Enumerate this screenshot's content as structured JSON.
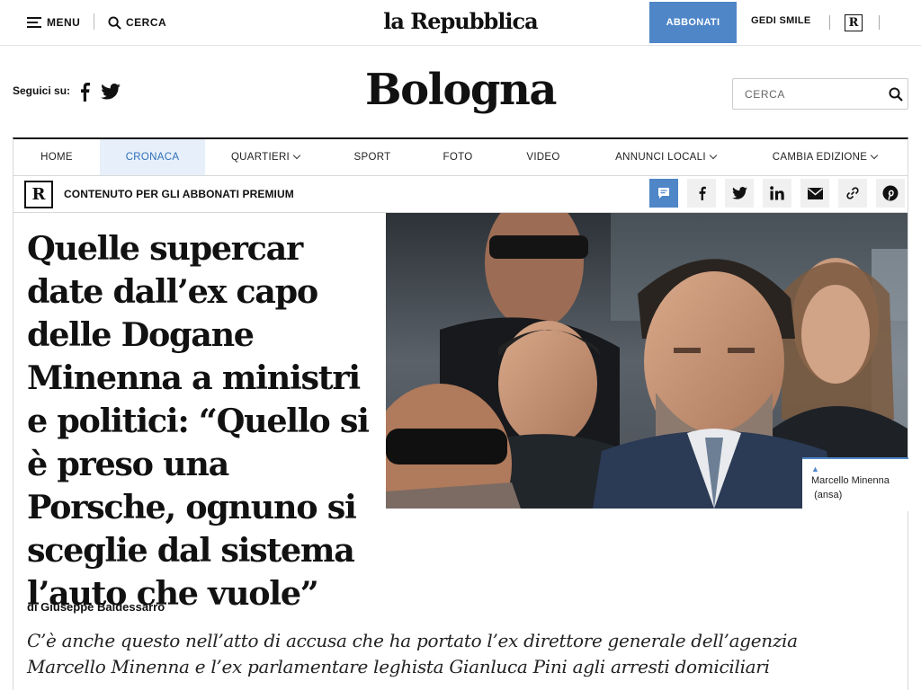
{
  "topbar": {
    "menu_label": "MENU",
    "search_label": "CERCA",
    "logo": "la Repubblica",
    "subscribe_label": "ABBONATI",
    "gedi_label": "GEDI SMILE",
    "r_badge": "R"
  },
  "header": {
    "follow_label": "Seguici su:",
    "city": "Bologna",
    "search_placeholder": "CERCA"
  },
  "nav": {
    "items": [
      {
        "label": "HOME"
      },
      {
        "label": "CRONACA",
        "active": true
      },
      {
        "label": "QUARTIERI",
        "dropdown": true
      },
      {
        "label": "SPORT"
      },
      {
        "label": "FOTO"
      },
      {
        "label": "VIDEO"
      },
      {
        "label": "ANNUNCI LOCALI",
        "dropdown": true
      },
      {
        "label": "CAMBIA EDIZIONE",
        "dropdown": true
      }
    ]
  },
  "premium": {
    "badge": "R",
    "label": "CONTENUTO PER GLI ABBONATI PREMIUM"
  },
  "share_icons": [
    "comment-icon",
    "facebook-icon",
    "twitter-icon",
    "linkedin-icon",
    "mail-icon",
    "link-icon",
    "pinterest-icon"
  ],
  "article": {
    "headline": "Quelle supercar date dall’ex capo delle Dogane Minenna a ministri e politici: “Quello si è preso una Porsche, ognuno si sceglie dal sistema l’auto che vuole”",
    "caption_name": "Marcello Minenna",
    "caption_credit": "(ansa)",
    "author": "di Giuseppe Baldessarro",
    "summary": "C’è anche questo nell’atto di accusa che ha portato l’ex direttore generale dell’agenzia Marcello Minenna e l’ex parlamentare leghista Gianluca Pini agli arresti domiciliari"
  },
  "colors": {
    "accent": "#4f86c8",
    "nav_active_bg": "#e7f0fa",
    "nav_active_text": "#2f6fb8"
  }
}
